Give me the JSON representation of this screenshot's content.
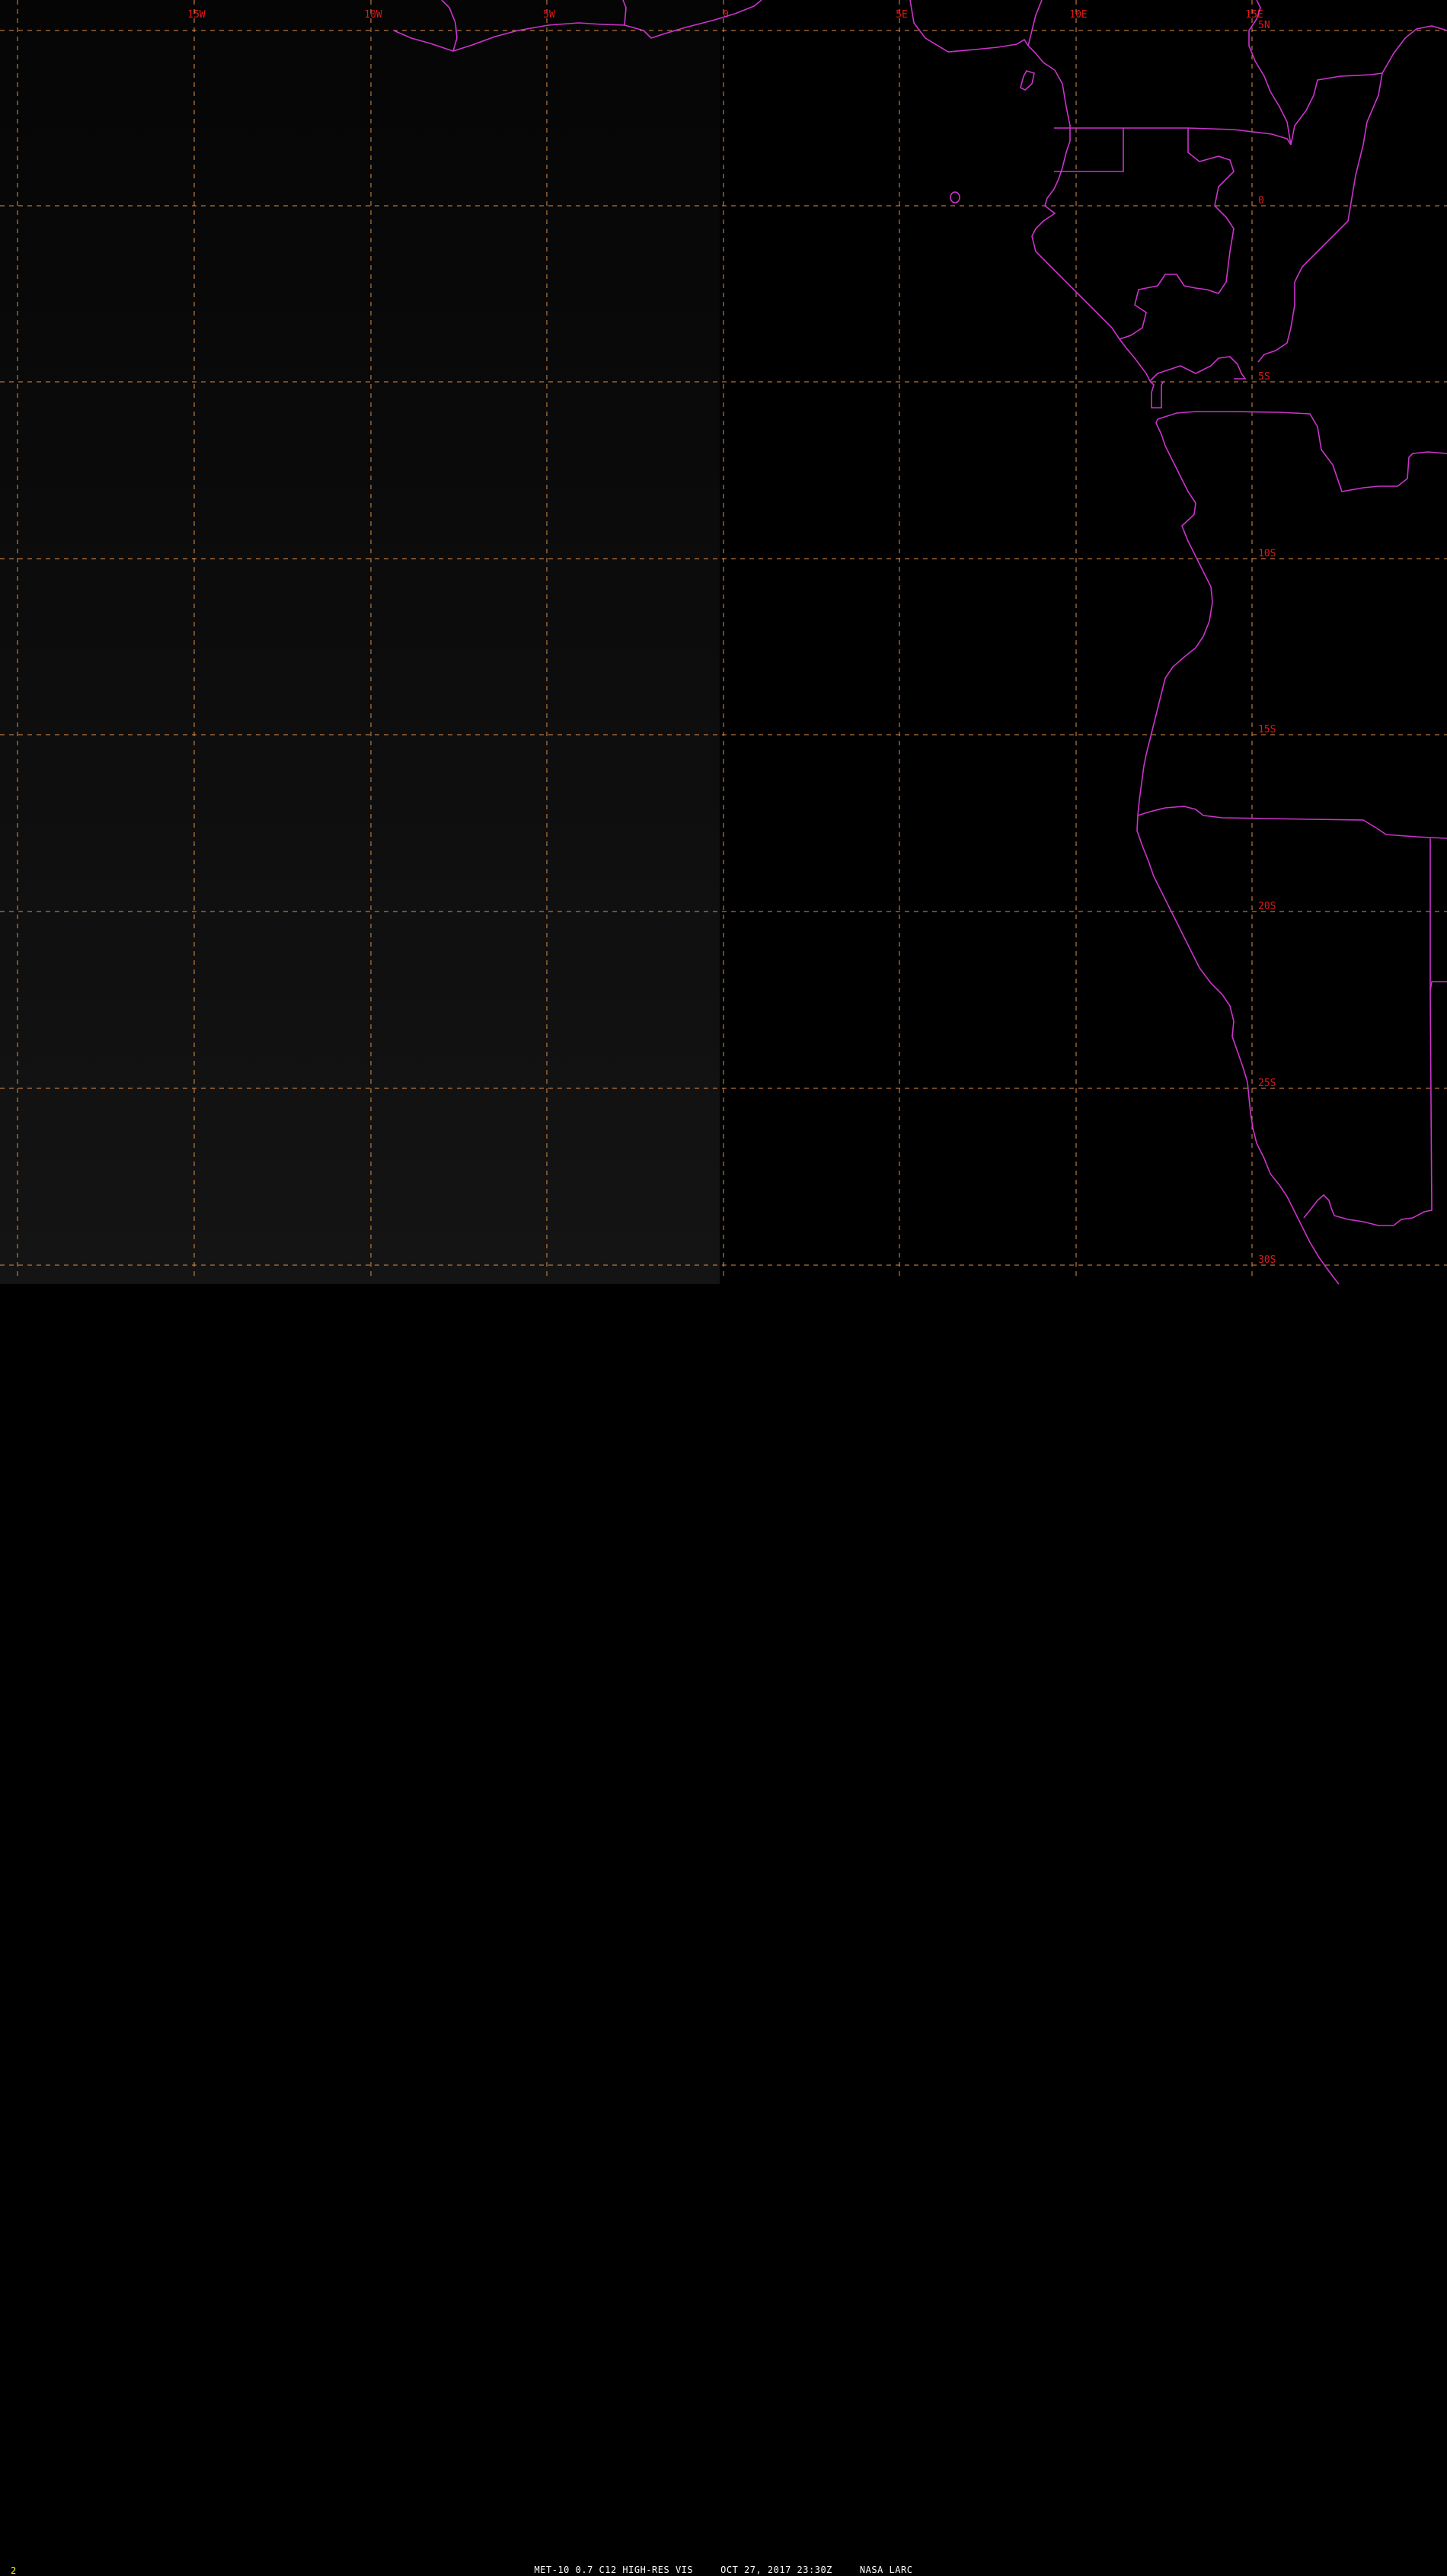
{
  "map": {
    "colors": {
      "background": "#000000",
      "grid": "#e0904a",
      "grid_labels": "#e01818",
      "coastlines": "#cc33cc",
      "frame_number": "#ffff00",
      "caption": "#ffffff"
    },
    "longitude_labels": [
      "15W",
      "10W",
      "5W",
      "0",
      "5E",
      "10E",
      "15E"
    ],
    "latitude_labels": [
      "5N",
      "0",
      "5S",
      "10S",
      "15S",
      "20S",
      "25S",
      "30S"
    ],
    "icons": {
      "grid": "dashed-graticule",
      "borders": "coastline-and-border-lines"
    }
  },
  "footer": {
    "frame_number": "2",
    "satellite": "MET-10 0.7 C12 HIGH-RES VIS",
    "datetime": "OCT 27, 2017 23:30Z",
    "source": "NASA LARC"
  }
}
